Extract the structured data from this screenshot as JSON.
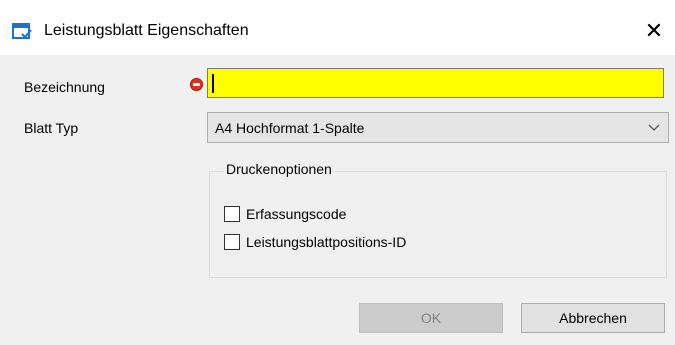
{
  "window": {
    "title": "Leistungsblatt Eigenschaften",
    "close_glyph": "✕",
    "icon": "app-window-icon"
  },
  "form": {
    "name_label": "Bezeichnung",
    "name_value": "",
    "name_error_icon": "error-minus-icon",
    "name_bg_color": "#ffff00",
    "type_label": "Blatt Typ",
    "type_value": "A4 Hochformat 1-Spalte"
  },
  "print_options": {
    "legend": "Druckenoptionen",
    "items": [
      {
        "label": "Erfassungscode",
        "checked": false
      },
      {
        "label": "Leistungsblattpositions-ID",
        "checked": false
      }
    ]
  },
  "buttons": {
    "ok": "OK",
    "ok_enabled": false,
    "cancel": "Abbrechen"
  }
}
